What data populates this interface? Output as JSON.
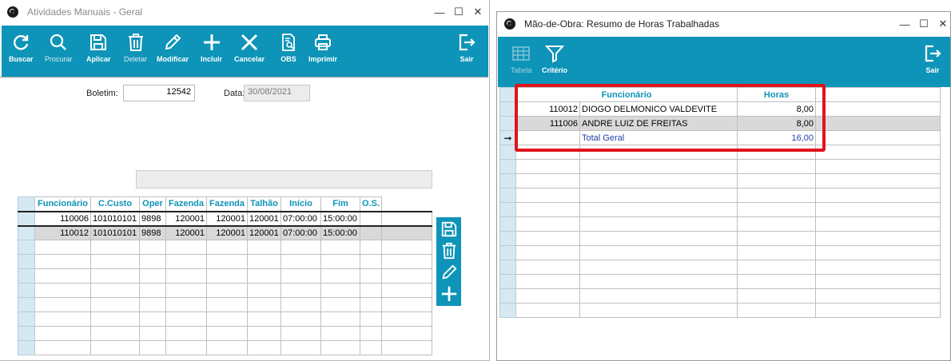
{
  "left_window": {
    "title": "Atividades Manuais - Geral",
    "toolbar": [
      {
        "label": "Buscar",
        "icon": "refresh-icon",
        "style": "bold"
      },
      {
        "label": "Procurar",
        "icon": "search-icon",
        "style": "dim"
      },
      {
        "label": "Aplicar",
        "icon": "save-icon",
        "style": "bold"
      },
      {
        "label": "Deletar",
        "icon": "trash-icon",
        "style": "dim"
      },
      {
        "label": "Modificar",
        "icon": "pencil-icon",
        "style": "bold"
      },
      {
        "label": "Incluir",
        "icon": "plus-icon",
        "style": "bold"
      },
      {
        "label": "Cancelar",
        "icon": "x-icon",
        "style": "bold"
      },
      {
        "label": "OBS",
        "icon": "document-search-icon",
        "style": "bold"
      },
      {
        "label": "Imprimir",
        "icon": "printer-icon",
        "style": "bold"
      },
      {
        "label": "Sair",
        "icon": "exit-icon",
        "style": "bold"
      }
    ],
    "form": {
      "boletim_label": "Boletim:",
      "boletim_value": "12542",
      "data_label": "Data:",
      "data_value": "30/08/2021"
    },
    "grid": {
      "columns": [
        "Funcionário",
        "C.Custo",
        "Oper",
        "Fazenda",
        "Fazenda",
        "Talhão",
        "Início",
        "Fim",
        "O.S."
      ],
      "rows": [
        [
          "110006",
          "101010101",
          "9898",
          "120001",
          "120001",
          "120001",
          "07:00:00",
          "15:00:00",
          ""
        ],
        [
          "110012",
          "101010101",
          "9898",
          "120001",
          "120001",
          "120001",
          "07:00:00",
          "15:00:00",
          ""
        ]
      ]
    },
    "side_tools": [
      "save-icon",
      "trash-icon",
      "pencil-icon",
      "plus-icon"
    ]
  },
  "right_window": {
    "title": "Mão-de-Obra: Resumo de Horas Trabalhadas",
    "toolbar": [
      {
        "label": "Tabela",
        "icon": "table-icon",
        "style": "off"
      },
      {
        "label": "Critério",
        "icon": "filter-icon",
        "style": "bold"
      },
      {
        "label": "Sair",
        "icon": "exit-icon",
        "style": "bold"
      }
    ],
    "grid": {
      "columns": [
        "Funcionário",
        "Horas"
      ],
      "rows": [
        {
          "code": "110012",
          "name": "DIOGO DELMONICO VALDEVITE",
          "horas": "8,00"
        },
        {
          "code": "111006",
          "name": "ANDRE LUIZ DE FREITAS",
          "horas": "8,00"
        }
      ],
      "total_label": "Total Geral",
      "total_value": "16,00"
    }
  },
  "colors": {
    "accent": "#0e94b8",
    "highlight": "#e0151b",
    "row_selected": "#d9d9d9",
    "indicator": "#d6e9f2"
  }
}
